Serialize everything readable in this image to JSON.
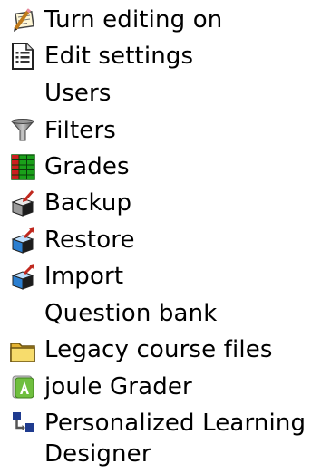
{
  "admin_menu": {
    "items": [
      {
        "label": "Turn editing on",
        "icon": "edit-pencil-icon"
      },
      {
        "label": "Edit settings",
        "icon": "settings-document-icon"
      },
      {
        "label": "Users",
        "icon": ""
      },
      {
        "label": "Filters",
        "icon": "filter-funnel-icon"
      },
      {
        "label": "Grades",
        "icon": "grades-spreadsheet-icon"
      },
      {
        "label": "Backup",
        "icon": "backup-box-icon"
      },
      {
        "label": "Restore",
        "icon": "restore-box-icon"
      },
      {
        "label": "Import",
        "icon": "import-box-icon"
      },
      {
        "label": "Question bank",
        "icon": ""
      },
      {
        "label": "Legacy course files",
        "icon": "folder-icon"
      },
      {
        "label": "joule Grader",
        "icon": "joule-grader-icon"
      },
      {
        "label": "Personalized Learning",
        "label_line2": "Designer",
        "icon": "personalized-learning-designer-icon"
      }
    ]
  },
  "colors": {
    "text": "#000000",
    "background": "#ffffff",
    "grades_green": "#1aa01a",
    "grades_red": "#cc1f1f",
    "arrow_red": "#c0281e",
    "box_blue": "#2b7fd1",
    "folder_yellow": "#f2cf4a",
    "joule_green": "#6fbf3e",
    "pld_blue": "#1f3b8f"
  }
}
